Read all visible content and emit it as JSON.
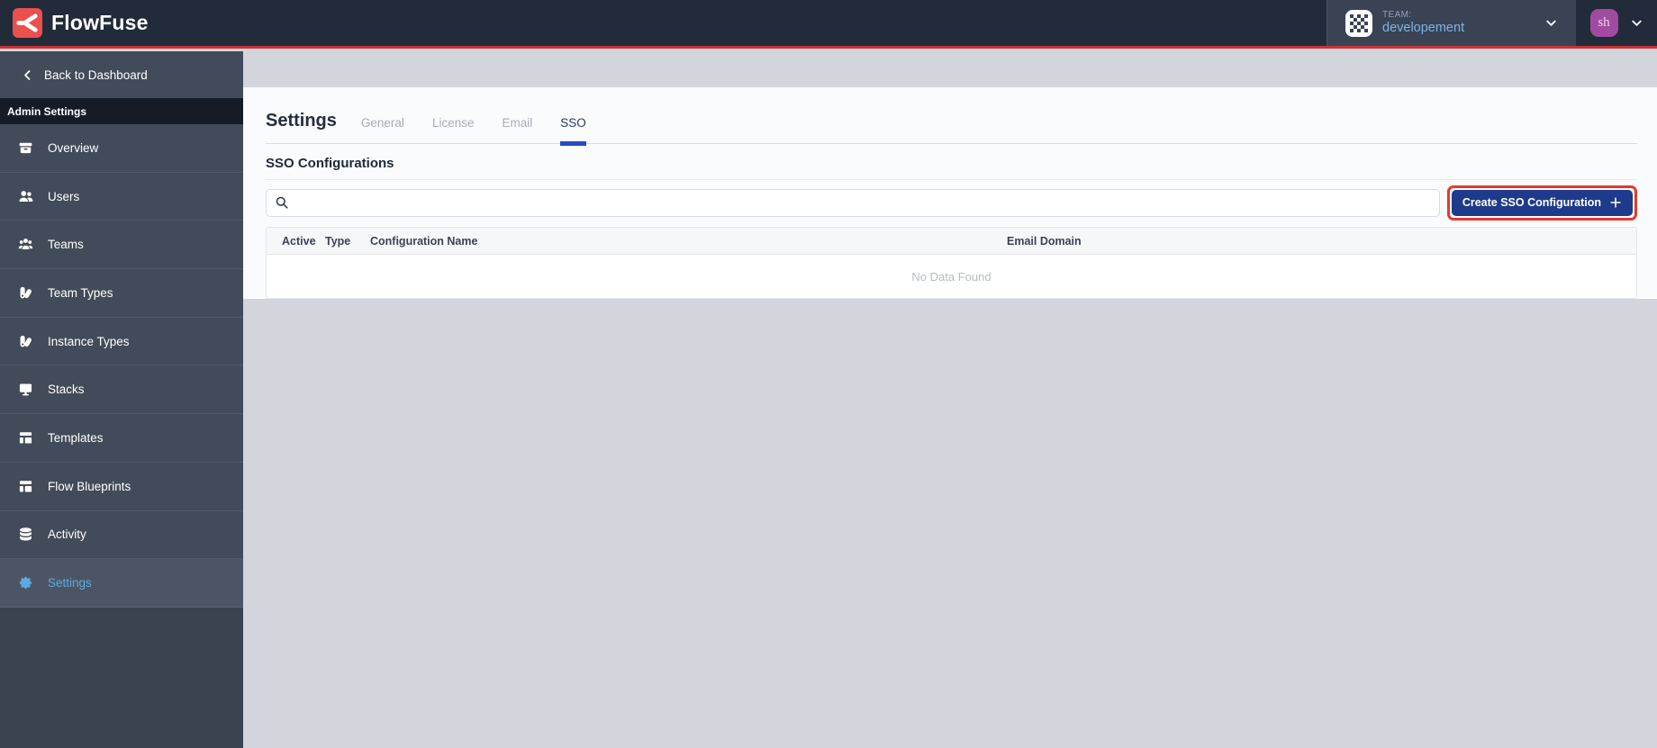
{
  "navbar": {
    "brand": "FlowFuse",
    "team": {
      "kicker": "TEAM:",
      "name": "developement"
    },
    "avatar_initials": "sh"
  },
  "sidebar": {
    "back_label": "Back to Dashboard",
    "section_label": "Admin Settings",
    "items": [
      {
        "label": "Overview",
        "icon": "archive-icon",
        "active": false
      },
      {
        "label": "Users",
        "icon": "users-icon",
        "active": false
      },
      {
        "label": "Teams",
        "icon": "user-group-icon",
        "active": false
      },
      {
        "label": "Team Types",
        "icon": "color-swatch-icon",
        "active": false
      },
      {
        "label": "Instance Types",
        "icon": "color-swatch-icon",
        "active": false
      },
      {
        "label": "Stacks",
        "icon": "desktop-icon",
        "active": false
      },
      {
        "label": "Templates",
        "icon": "template-icon",
        "active": false
      },
      {
        "label": "Flow Blueprints",
        "icon": "template-icon",
        "active": false
      },
      {
        "label": "Activity",
        "icon": "database-icon",
        "active": false
      },
      {
        "label": "Settings",
        "icon": "cog-icon",
        "active": true
      }
    ]
  },
  "main": {
    "title": "Settings",
    "tabs": [
      {
        "label": "General",
        "active": false
      },
      {
        "label": "License",
        "active": false
      },
      {
        "label": "Email",
        "active": false
      },
      {
        "label": "SSO",
        "active": true
      }
    ],
    "section_title": "SSO Configurations",
    "search": {
      "value": "",
      "placeholder": ""
    },
    "create_button": {
      "label": "Create SSO Configuration",
      "icon": "plus-icon"
    },
    "table": {
      "columns": [
        "Active",
        "Type",
        "Configuration Name",
        "Email Domain"
      ],
      "rows": [],
      "empty_text": "No Data Found"
    }
  },
  "colors": {
    "brand_red": "#e9504e",
    "navbar_bg": "#222b3a",
    "navbar_red_line": "#ce3232",
    "sidebar_bg": "#424b59",
    "sidebar_active_bg": "#4d5565",
    "active_item_blue": "#58ace2",
    "team_name_blue": "#7db2e6",
    "button_blue": "#1e3a8a",
    "tab_underline_blue": "#2a49c4",
    "annotation_red": "#e6392f",
    "avatar_purple": "#a04ba0",
    "content_gray": "#d2d5db",
    "panel_bg": "#fafbfc"
  }
}
